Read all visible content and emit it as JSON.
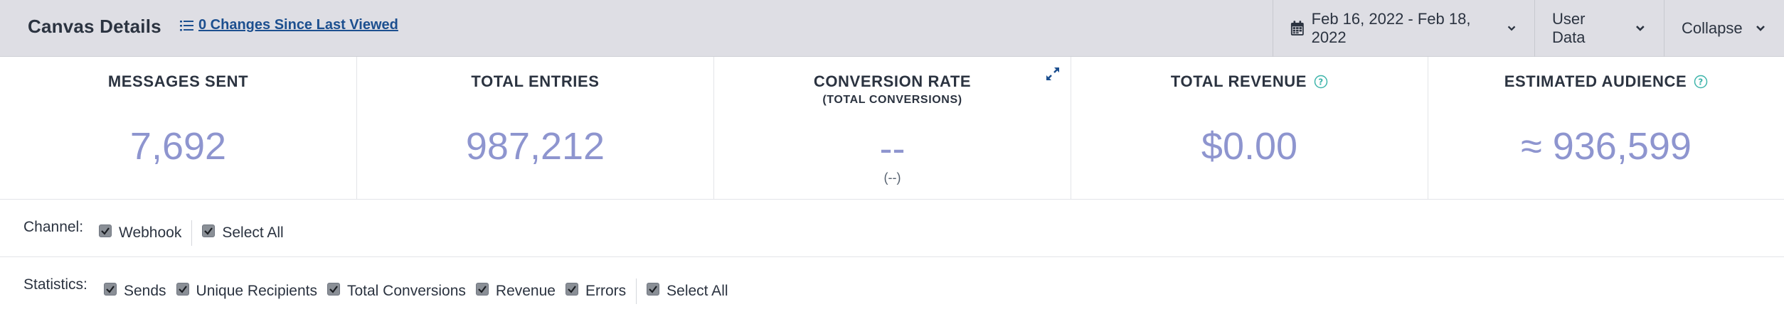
{
  "header": {
    "title": "Canvas Details",
    "changes_link": "0 Changes Since Last Viewed",
    "date_range": "Feb 16, 2022 - Feb 18, 2022",
    "user_data": "User Data",
    "collapse": "Collapse"
  },
  "metrics": [
    {
      "label": "MESSAGES SENT",
      "value": "7,692"
    },
    {
      "label": "TOTAL ENTRIES",
      "value": "987,212"
    },
    {
      "label": "CONVERSION RATE",
      "sublabel": "(TOTAL CONVERSIONS)",
      "value": "--",
      "subvalue": "(--)"
    },
    {
      "label": "TOTAL REVENUE",
      "value": "$0.00"
    },
    {
      "label": "ESTIMATED AUDIENCE",
      "value": "≈ 936,599"
    }
  ],
  "channel_filter": {
    "label": "Channel:",
    "options": [
      "Webhook",
      "Select All"
    ]
  },
  "statistics_filter": {
    "label": "Statistics:",
    "options": [
      "Sends",
      "Unique Recipients",
      "Total Conversions",
      "Revenue",
      "Errors",
      "Select All"
    ]
  },
  "colors": {
    "header_bg": "#dedee4",
    "link": "#1c4f8f",
    "metric_value": "#8e95cf",
    "help_icon": "#3fb5ab"
  },
  "icons": {
    "changes": "list-icon",
    "date": "calendar-icon",
    "dropdown": "chevron-down-icon",
    "help": "help-circle-icon",
    "expand": "expand-icon",
    "checkbox": "checkbox-checked-icon"
  }
}
